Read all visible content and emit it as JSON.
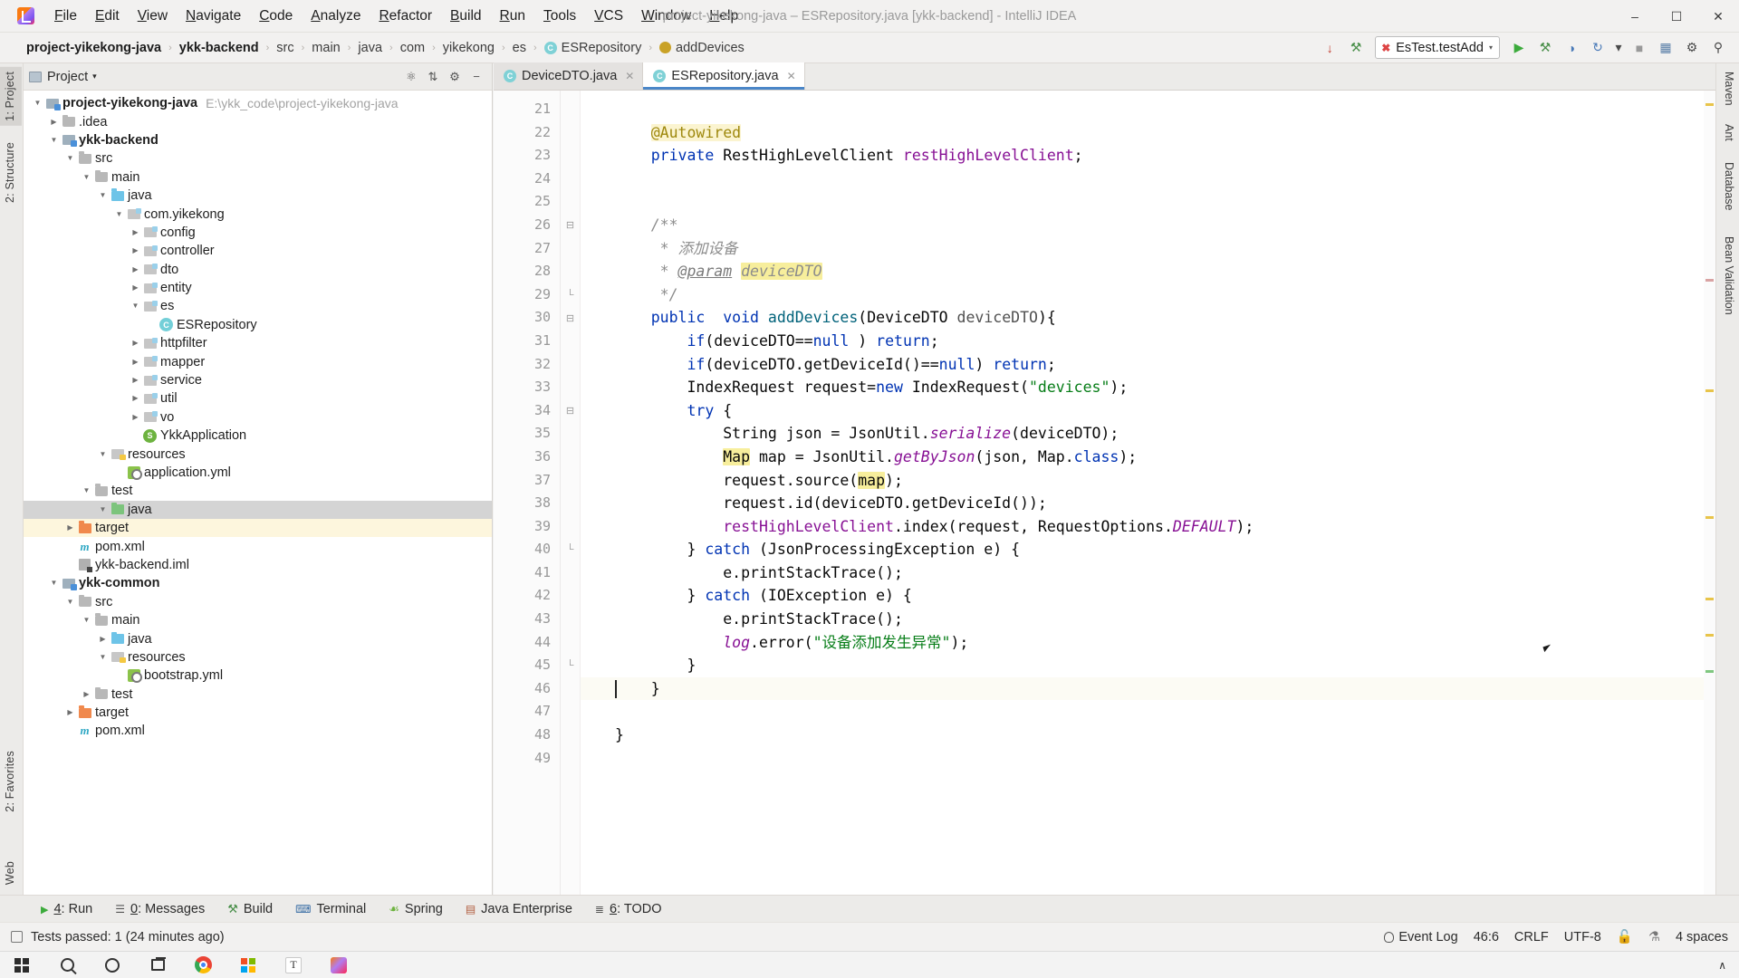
{
  "window": {
    "title": "project-yikekong-java  –  ESRepository.java [ykk-backend] - IntelliJ IDEA",
    "minimize": "–",
    "maximize": "☐",
    "close": "✕"
  },
  "menu": {
    "items": [
      "File",
      "Edit",
      "View",
      "Navigate",
      "Code",
      "Analyze",
      "Refactor",
      "Build",
      "Run",
      "Tools",
      "VCS",
      "Window",
      "Help"
    ]
  },
  "breadcrumb": {
    "items": [
      {
        "label": "project-yikekong-java",
        "bold": true,
        "icon": ""
      },
      {
        "label": "ykk-backend",
        "bold": true,
        "icon": ""
      },
      {
        "label": "src",
        "bold": false,
        "icon": ""
      },
      {
        "label": "main",
        "bold": false,
        "icon": ""
      },
      {
        "label": "java",
        "bold": false,
        "icon": ""
      },
      {
        "label": "com",
        "bold": false,
        "icon": ""
      },
      {
        "label": "yikekong",
        "bold": false,
        "icon": ""
      },
      {
        "label": "es",
        "bold": false,
        "icon": ""
      },
      {
        "label": "ESRepository",
        "bold": false,
        "icon": "class-badge"
      },
      {
        "label": "addDevices",
        "bold": false,
        "icon": "method-badge"
      }
    ],
    "separator": "›"
  },
  "toolbar": {
    "download_icon": "↓",
    "build_icon": "⚒",
    "run_config": "EsTest.testAdd",
    "run_config_caret": "▾",
    "run_icon": "▶",
    "debug_icon": "⚒",
    "coverage_icon": "◷",
    "profile_icon": "↻",
    "more_caret": "▾",
    "stop_icon": "■",
    "layout_icon": "▤",
    "settings_icon": "⚙",
    "search_icon": "⚲"
  },
  "left_strip": {
    "items": [
      "1: Project",
      "2: Structure"
    ],
    "bottom_items": [
      "2: Favorites",
      "Web"
    ]
  },
  "right_strip": {
    "items": [
      "Maven",
      "Ant",
      "Database",
      "Bean Validation"
    ]
  },
  "project_panel": {
    "title": "Project",
    "title_caret": "▾",
    "tools": [
      "⊕",
      "⇵",
      "⚙",
      "−",
      "↗"
    ],
    "tree": [
      {
        "depth": 0,
        "label": "project-yikekong-java",
        "path": "E:\\ykk_code\\project-yikekong-java",
        "icon": "module",
        "arrow": "open",
        "bold": true
      },
      {
        "depth": 1,
        "label": ".idea",
        "icon": "folder-gray",
        "arrow": "closed",
        "bold": false
      },
      {
        "depth": 1,
        "label": "ykk-backend",
        "icon": "module",
        "arrow": "open",
        "bold": true
      },
      {
        "depth": 2,
        "label": "src",
        "icon": "folder-gray",
        "arrow": "open",
        "bold": false
      },
      {
        "depth": 3,
        "label": "main",
        "icon": "folder-gray",
        "arrow": "open",
        "bold": false
      },
      {
        "depth": 4,
        "label": "java",
        "icon": "folder-blue",
        "arrow": "open",
        "bold": false
      },
      {
        "depth": 5,
        "label": "com.yikekong",
        "icon": "package",
        "arrow": "open",
        "bold": false
      },
      {
        "depth": 6,
        "label": "config",
        "icon": "package",
        "arrow": "closed",
        "bold": false
      },
      {
        "depth": 6,
        "label": "controller",
        "icon": "package",
        "arrow": "closed",
        "bold": false
      },
      {
        "depth": 6,
        "label": "dto",
        "icon": "package",
        "arrow": "closed",
        "bold": false
      },
      {
        "depth": 6,
        "label": "entity",
        "icon": "package",
        "arrow": "closed",
        "bold": false
      },
      {
        "depth": 6,
        "label": "es",
        "icon": "package",
        "arrow": "open",
        "bold": false
      },
      {
        "depth": 7,
        "label": "ESRepository",
        "icon": "class",
        "arrow": "none",
        "bold": false
      },
      {
        "depth": 6,
        "label": "httpfilter",
        "icon": "package",
        "arrow": "closed",
        "bold": false
      },
      {
        "depth": 6,
        "label": "mapper",
        "icon": "package",
        "arrow": "closed",
        "bold": false
      },
      {
        "depth": 6,
        "label": "service",
        "icon": "package",
        "arrow": "closed",
        "bold": false
      },
      {
        "depth": 6,
        "label": "util",
        "icon": "package",
        "arrow": "closed",
        "bold": false
      },
      {
        "depth": 6,
        "label": "vo",
        "icon": "package",
        "arrow": "closed",
        "bold": false
      },
      {
        "depth": 6,
        "label": "YkkApplication",
        "icon": "spring",
        "arrow": "none",
        "bold": false
      },
      {
        "depth": 4,
        "label": "resources",
        "icon": "resources",
        "arrow": "open",
        "bold": false
      },
      {
        "depth": 5,
        "label": "application.yml",
        "icon": "yml",
        "arrow": "none",
        "bold": false
      },
      {
        "depth": 3,
        "label": "test",
        "icon": "folder-gray",
        "arrow": "open",
        "bold": false
      },
      {
        "depth": 4,
        "label": "java",
        "icon": "folder-green",
        "arrow": "open",
        "bold": false,
        "state": "selected"
      },
      {
        "depth": 2,
        "label": "target",
        "icon": "folder-orange",
        "arrow": "closed",
        "bold": false,
        "state": "highlight"
      },
      {
        "depth": 2,
        "label": "pom.xml",
        "icon": "xml",
        "arrow": "none",
        "bold": false
      },
      {
        "depth": 2,
        "label": "ykk-backend.iml",
        "icon": "iml",
        "arrow": "none",
        "bold": false
      },
      {
        "depth": 1,
        "label": "ykk-common",
        "icon": "module",
        "arrow": "open",
        "bold": true
      },
      {
        "depth": 2,
        "label": "src",
        "icon": "folder-gray",
        "arrow": "open",
        "bold": false
      },
      {
        "depth": 3,
        "label": "main",
        "icon": "folder-gray",
        "arrow": "open",
        "bold": false
      },
      {
        "depth": 4,
        "label": "java",
        "icon": "folder-blue",
        "arrow": "closed",
        "bold": false
      },
      {
        "depth": 4,
        "label": "resources",
        "icon": "resources",
        "arrow": "open",
        "bold": false
      },
      {
        "depth": 5,
        "label": "bootstrap.yml",
        "icon": "yml",
        "arrow": "none",
        "bold": false
      },
      {
        "depth": 3,
        "label": "test",
        "icon": "folder-gray",
        "arrow": "closed",
        "bold": false
      },
      {
        "depth": 2,
        "label": "target",
        "icon": "folder-orange",
        "arrow": "closed",
        "bold": false
      },
      {
        "depth": 2,
        "label": "pom.xml",
        "icon": "xml",
        "arrow": "none",
        "bold": false
      }
    ]
  },
  "editor": {
    "tabs": [
      {
        "label": "DeviceDTO.java",
        "active": false,
        "close": "✕"
      },
      {
        "label": "ESRepository.java",
        "active": true,
        "close": "✕"
      }
    ],
    "first_line_number": 21,
    "lines": [
      {
        "n": 21,
        "fold": "",
        "mark": "",
        "tokens": []
      },
      {
        "n": 22,
        "fold": "",
        "mark": "",
        "tokens": [
          {
            "t": "    ",
            "c": "plain"
          },
          {
            "t": "@Autowired",
            "c": "anno hl-soft"
          }
        ]
      },
      {
        "n": 23,
        "fold": "",
        "mark": "bean",
        "tokens": [
          {
            "t": "    ",
            "c": "plain"
          },
          {
            "t": "private",
            "c": "kw"
          },
          {
            "t": " RestHighLevelClient ",
            "c": "plain"
          },
          {
            "t": "restHighLevelClient",
            "c": "fld"
          },
          {
            "t": ";",
            "c": "plain"
          }
        ]
      },
      {
        "n": 24,
        "fold": "",
        "mark": "",
        "tokens": []
      },
      {
        "n": 25,
        "fold": "",
        "mark": "",
        "tokens": []
      },
      {
        "n": 26,
        "fold": "foldstart",
        "mark": "doc",
        "tokens": [
          {
            "t": "    ",
            "c": "plain"
          },
          {
            "t": "/**",
            "c": "cmt"
          }
        ]
      },
      {
        "n": 27,
        "fold": "",
        "mark": "",
        "tokens": [
          {
            "t": "     * ",
            "c": "cmt"
          },
          {
            "t": "添加设备",
            "c": "cmt"
          }
        ]
      },
      {
        "n": 28,
        "fold": "",
        "mark": "",
        "tokens": [
          {
            "t": "     * ",
            "c": "cmt"
          },
          {
            "t": "@param",
            "c": "cmt-tag"
          },
          {
            "t": " ",
            "c": "cmt"
          },
          {
            "t": "deviceDTO",
            "c": "cmt hl-y"
          }
        ]
      },
      {
        "n": 29,
        "fold": "foldend",
        "mark": "",
        "tokens": [
          {
            "t": "     */",
            "c": "cmt"
          }
        ]
      },
      {
        "n": 30,
        "fold": "foldstart",
        "mark": "",
        "tokens": [
          {
            "t": "    ",
            "c": "plain"
          },
          {
            "t": "public",
            "c": "kw"
          },
          {
            "t": "  ",
            "c": "plain"
          },
          {
            "t": "void",
            "c": "kw"
          },
          {
            "t": " ",
            "c": "plain"
          },
          {
            "t": "addDevices",
            "c": "meth"
          },
          {
            "t": "(DeviceDTO ",
            "c": "plain"
          },
          {
            "t": "deviceDTO",
            "c": "param"
          },
          {
            "t": "){",
            "c": "plain"
          }
        ]
      },
      {
        "n": 31,
        "fold": "",
        "mark": "",
        "tokens": [
          {
            "t": "        ",
            "c": "plain"
          },
          {
            "t": "if",
            "c": "kw"
          },
          {
            "t": "(deviceDTO==",
            "c": "plain"
          },
          {
            "t": "null",
            "c": "kw"
          },
          {
            "t": " ) ",
            "c": "plain"
          },
          {
            "t": "return",
            "c": "kw"
          },
          {
            "t": ";",
            "c": "plain"
          }
        ]
      },
      {
        "n": 32,
        "fold": "",
        "mark": "",
        "tokens": [
          {
            "t": "        ",
            "c": "plain"
          },
          {
            "t": "if",
            "c": "kw"
          },
          {
            "t": "(deviceDTO.getDeviceId()==",
            "c": "plain"
          },
          {
            "t": "null",
            "c": "kw"
          },
          {
            "t": ") ",
            "c": "plain"
          },
          {
            "t": "return",
            "c": "kw"
          },
          {
            "t": ";",
            "c": "plain"
          }
        ]
      },
      {
        "n": 33,
        "fold": "",
        "mark": "",
        "tokens": [
          {
            "t": "        IndexRequest request=",
            "c": "plain"
          },
          {
            "t": "new",
            "c": "kw"
          },
          {
            "t": " IndexRequest(",
            "c": "plain"
          },
          {
            "t": "\"devices\"",
            "c": "str"
          },
          {
            "t": ");",
            "c": "plain"
          }
        ]
      },
      {
        "n": 34,
        "fold": "foldstart",
        "mark": "",
        "tokens": [
          {
            "t": "        ",
            "c": "plain"
          },
          {
            "t": "try",
            "c": "kw"
          },
          {
            "t": " {",
            "c": "plain"
          }
        ]
      },
      {
        "n": 35,
        "fold": "",
        "mark": "",
        "tokens": [
          {
            "t": "            String json = JsonUtil.",
            "c": "plain"
          },
          {
            "t": "serialize",
            "c": "stat"
          },
          {
            "t": "(deviceDTO);",
            "c": "plain"
          }
        ]
      },
      {
        "n": 36,
        "fold": "",
        "mark": "",
        "tokens": [
          {
            "t": "            ",
            "c": "plain"
          },
          {
            "t": "Map",
            "c": "plain hl-y"
          },
          {
            "t": " map = JsonUtil.",
            "c": "plain"
          },
          {
            "t": "getByJson",
            "c": "stat"
          },
          {
            "t": "(json, Map.",
            "c": "plain"
          },
          {
            "t": "class",
            "c": "kw"
          },
          {
            "t": ");",
            "c": "plain"
          }
        ]
      },
      {
        "n": 37,
        "fold": "",
        "mark": "",
        "tokens": [
          {
            "t": "            request.source(",
            "c": "plain"
          },
          {
            "t": "map",
            "c": "plain hl-y"
          },
          {
            "t": ");",
            "c": "plain"
          }
        ]
      },
      {
        "n": 38,
        "fold": "",
        "mark": "",
        "tokens": [
          {
            "t": "            request.id(deviceDTO.getDeviceId());",
            "c": "plain"
          }
        ]
      },
      {
        "n": 39,
        "fold": "",
        "mark": "",
        "tokens": [
          {
            "t": "            ",
            "c": "plain"
          },
          {
            "t": "restHighLevelClient",
            "c": "fld"
          },
          {
            "t": ".index(request, RequestOptions.",
            "c": "plain"
          },
          {
            "t": "DEFAULT",
            "c": "stat"
          },
          {
            "t": ");",
            "c": "plain"
          }
        ]
      },
      {
        "n": 40,
        "fold": "foldend",
        "mark": "",
        "tokens": [
          {
            "t": "        } ",
            "c": "plain"
          },
          {
            "t": "catch",
            "c": "kw"
          },
          {
            "t": " (JsonProcessingException e) {",
            "c": "plain"
          }
        ]
      },
      {
        "n": 41,
        "fold": "",
        "mark": "",
        "tokens": [
          {
            "t": "            e.printStackTrace();",
            "c": "plain"
          }
        ]
      },
      {
        "n": 42,
        "fold": "",
        "mark": "",
        "tokens": [
          {
            "t": "        } ",
            "c": "plain"
          },
          {
            "t": "catch",
            "c": "kw"
          },
          {
            "t": " (IOException e) {",
            "c": "plain"
          }
        ]
      },
      {
        "n": 43,
        "fold": "",
        "mark": "",
        "tokens": [
          {
            "t": "            e.printStackTrace();",
            "c": "plain"
          }
        ]
      },
      {
        "n": 44,
        "fold": "",
        "mark": "",
        "tokens": [
          {
            "t": "            ",
            "c": "plain"
          },
          {
            "t": "log",
            "c": "stat"
          },
          {
            "t": ".error(",
            "c": "plain"
          },
          {
            "t": "\"设备添加发生异常\"",
            "c": "str"
          },
          {
            "t": ");",
            "c": "plain"
          }
        ]
      },
      {
        "n": 45,
        "fold": "foldend",
        "mark": "",
        "tokens": [
          {
            "t": "        }",
            "c": "plain"
          }
        ]
      },
      {
        "n": 46,
        "fold": "",
        "mark": "",
        "current": true,
        "tokens": [
          {
            "t": "    }",
            "c": "plain"
          }
        ]
      },
      {
        "n": 47,
        "fold": "",
        "mark": "",
        "tokens": []
      },
      {
        "n": 48,
        "fold": "",
        "mark": "",
        "tokens": [
          {
            "t": "}",
            "c": "plain"
          }
        ]
      },
      {
        "n": 49,
        "fold": "",
        "mark": "",
        "tokens": []
      }
    ]
  },
  "bottom_tools": {
    "items": [
      {
        "num": "4",
        "label": ": Run",
        "icon": "run-icon"
      },
      {
        "num": "0",
        "label": ": Messages",
        "icon": "messages-icon"
      },
      {
        "num": "",
        "label": "Build",
        "icon": "build-icon"
      },
      {
        "num": "",
        "label": "Terminal",
        "icon": "terminal-icon"
      },
      {
        "num": "",
        "label": "Spring",
        "icon": "spring-icon"
      },
      {
        "num": "",
        "label": "Java Enterprise",
        "icon": "java-ee-icon"
      },
      {
        "num": "6",
        "label": ": TODO",
        "icon": "todo-icon"
      }
    ]
  },
  "status_bar": {
    "message": "Tests passed: 1 (24 minutes ago)",
    "event_log": "Event Log",
    "caret_position": "46:6",
    "line_separator": "CRLF",
    "encoding": "UTF-8",
    "indent": "4 spaces",
    "lock_icon": "🔓",
    "inspection_icon": "⚗"
  },
  "taskbar": {
    "items": [
      "start-icon",
      "search-icon",
      "cortana-icon",
      "task-view-icon",
      "chrome-icon",
      "store-icon",
      "text-editor-icon",
      "intellij-icon"
    ],
    "tray_caret": "∧"
  }
}
